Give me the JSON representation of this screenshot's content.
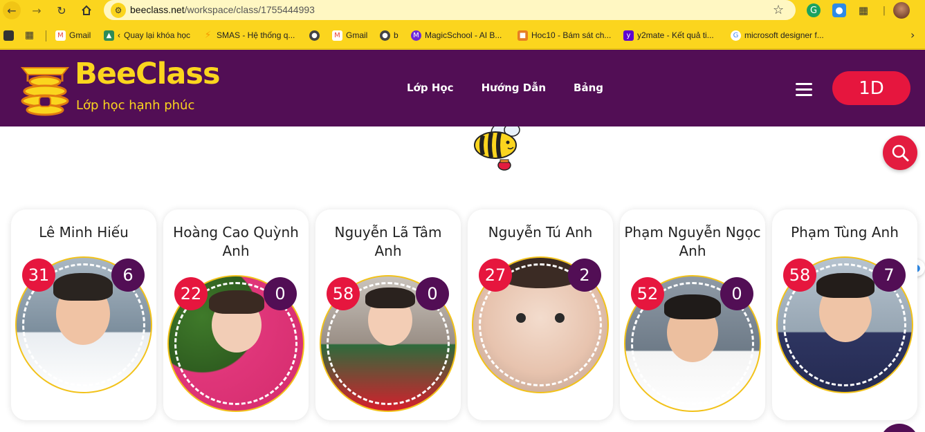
{
  "browser": {
    "url_host": "beeclass.net",
    "url_path": "/workspace/class/1755444993",
    "bookmarks": [
      {
        "label": "Gmail",
        "icon": "gmail-icon",
        "color": "#ea4335"
      },
      {
        "label": "Quay lại khóa học",
        "icon": "course-icon",
        "color": "#2e8b57"
      },
      {
        "label": "SMAS - Hệ thống q...",
        "icon": "smas-icon",
        "color": "#f59b00"
      },
      {
        "label": "",
        "icon": "globe-icon",
        "color": "#444444"
      },
      {
        "label": "Gmail",
        "icon": "gmail-icon",
        "color": "#ea4335"
      },
      {
        "label": "b",
        "icon": "globe-icon",
        "color": "#444444"
      },
      {
        "label": "MagicSchool - AI B...",
        "icon": "magicschool-icon",
        "color": "#6d28d9"
      },
      {
        "label": "Hoc10 - Bám sát ch...",
        "icon": "hoc10-icon",
        "color": "#e67e22"
      },
      {
        "label": "y2mate - Kết quả ti...",
        "icon": "yahoo-icon",
        "color": "#6001d2"
      },
      {
        "label": "microsoft designer f...",
        "icon": "google-icon",
        "color": "#4285f4"
      }
    ]
  },
  "header": {
    "logo_title": "BeeClass",
    "logo_subtitle": "Lớp học hạnh phúc",
    "nav": [
      "Lớp Học",
      "Hướng Dẫn",
      "Bảng"
    ],
    "class_badge": "1D",
    "brand_purple": "#520e55",
    "brand_yellow": "#fbd51e",
    "accent_red": "#e6163e"
  },
  "students": [
    {
      "name": "Lê Minh Hiếu",
      "points": "31",
      "penalties": "6"
    },
    {
      "name": "Hoàng Cao Quỳnh Anh",
      "points": "22",
      "penalties": "0"
    },
    {
      "name": "Nguyễn Lã Tâm Anh",
      "points": "58",
      "penalties": "0"
    },
    {
      "name": "Nguyễn Tú Anh",
      "points": "27",
      "penalties": "2"
    },
    {
      "name": "Phạm Nguyễn Ngọc Anh",
      "points": "52",
      "penalties": "0"
    },
    {
      "name": "Phạm Tùng Anh",
      "points": "58",
      "penalties": "7"
    }
  ]
}
